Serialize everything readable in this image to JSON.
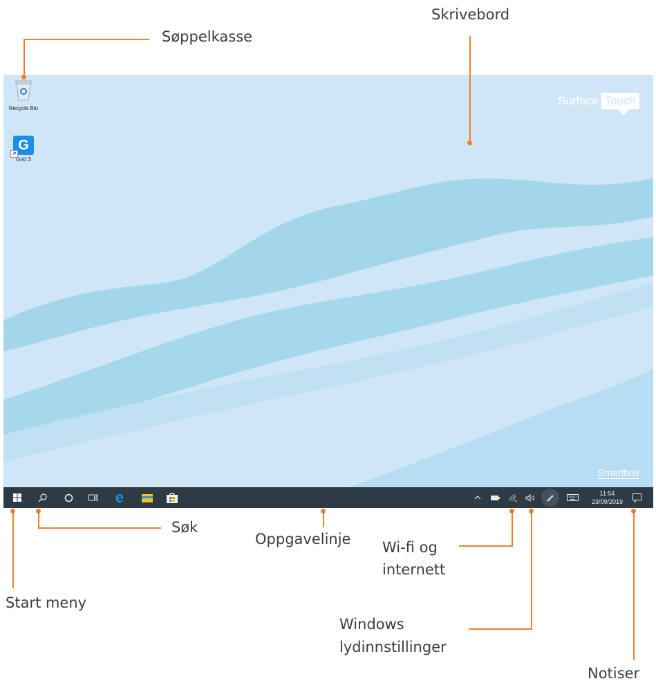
{
  "annotations": {
    "recycle_bin": "Søppelkasse",
    "desktop": "Skrivebord",
    "search": "Søk",
    "taskbar": "Oppgavelinje",
    "wifi_line1": "Wi-fi og",
    "wifi_line2": "internett",
    "start": "Start meny",
    "sound_line1": "Windows",
    "sound_line2": "lydinnstillinger",
    "notifications": "Notiser"
  },
  "desktop": {
    "icons": [
      {
        "label": "Recycle Bin",
        "icon": "recycle-bin-icon"
      },
      {
        "label": "Grid 3",
        "icon": "grid3-app-icon",
        "letter": "G"
      }
    ],
    "brand": {
      "surface": "Surface",
      "touch": "Touch"
    },
    "footer_brand": "Smartbox"
  },
  "taskbar": {
    "left_icons": [
      "windows-start-icon",
      "search-icon",
      "cortana-icon",
      "task-view-icon",
      "edge-icon",
      "file-explorer-icon",
      "store-icon"
    ],
    "tray_icons": [
      "chevron-up-icon",
      "battery-icon",
      "wifi-icon",
      "speaker-icon",
      "pen-icon",
      "keyboard-icon",
      "notification-icon"
    ],
    "clock_time": "11:54",
    "clock_date": "23/09/2019"
  },
  "colors": {
    "accent": "#ee7f2d",
    "taskbar": "#2e3a44",
    "desktop_bg": "#cfe6f6",
    "wave": "#a3d6ea",
    "edge_blue": "#1b8ee8",
    "folder_yellow": "#f2c21b"
  }
}
